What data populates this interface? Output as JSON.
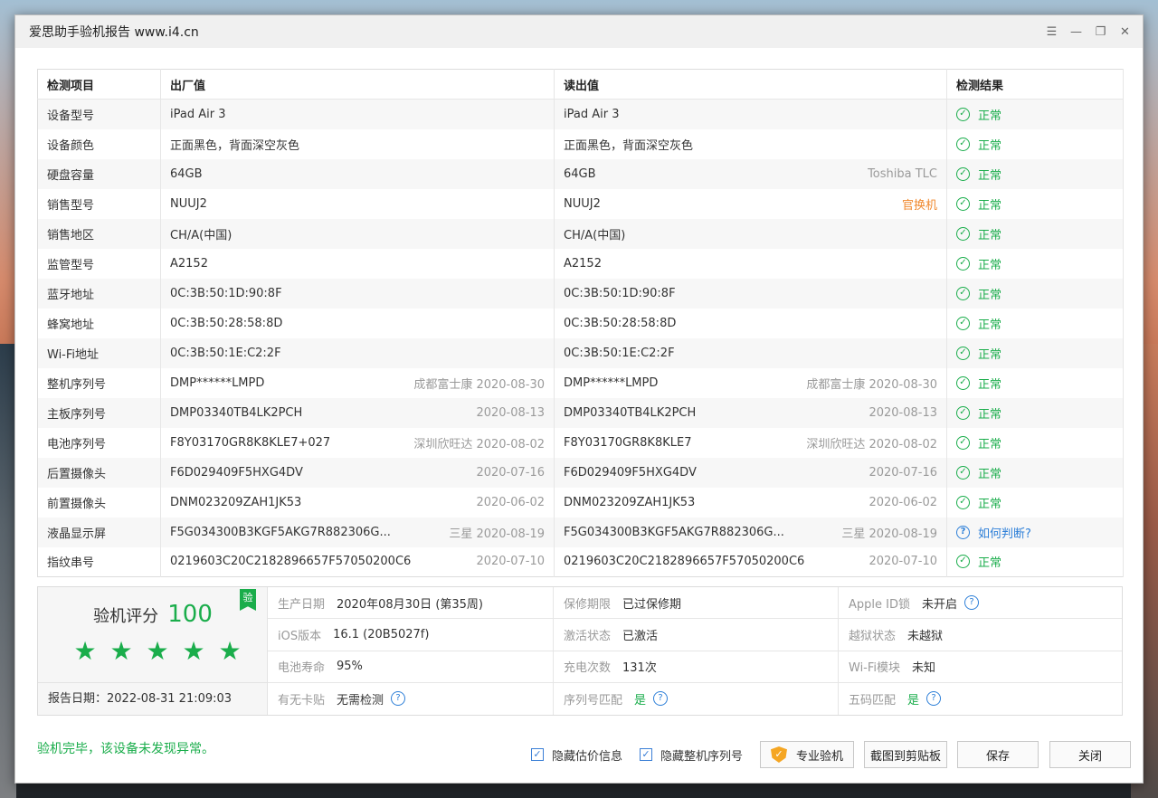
{
  "window": {
    "title": "爱思助手验机报告 www.i4.cn"
  },
  "icons": {
    "menu": "menu-icon",
    "minimize": "minimize-icon",
    "restore": "restore-icon",
    "close": "close-icon"
  },
  "table": {
    "headers": [
      "检测项目",
      "出厂值",
      "读出值",
      "检测结果"
    ],
    "rows": [
      {
        "item": "设备型号",
        "factory": "iPad Air 3",
        "factory_extra": "",
        "read": "iPad Air 3",
        "read_extra": "",
        "result": "正常",
        "result_type": "ok"
      },
      {
        "item": "设备颜色",
        "factory": "正面黑色，背面深空灰色",
        "factory_extra": "",
        "read": "正面黑色，背面深空灰色",
        "read_extra": "",
        "result": "正常",
        "result_type": "ok"
      },
      {
        "item": "硬盘容量",
        "factory": "64GB",
        "factory_extra": "",
        "read": "64GB",
        "read_extra": "Toshiba TLC",
        "result": "正常",
        "result_type": "ok"
      },
      {
        "item": "销售型号",
        "factory": "NUUJ2",
        "factory_extra": "",
        "read": "NUUJ2",
        "read_extra": "官换机",
        "read_extra_color": "orange",
        "result": "正常",
        "result_type": "ok"
      },
      {
        "item": "销售地区",
        "factory": "CH/A(中国)",
        "factory_extra": "",
        "read": "CH/A(中国)",
        "read_extra": "",
        "result": "正常",
        "result_type": "ok"
      },
      {
        "item": "监管型号",
        "factory": "A2152",
        "factory_extra": "",
        "read": "A2152",
        "read_extra": "",
        "result": "正常",
        "result_type": "ok"
      },
      {
        "item": "蓝牙地址",
        "factory": "0C:3B:50:1D:90:8F",
        "factory_extra": "",
        "read": "0C:3B:50:1D:90:8F",
        "read_extra": "",
        "result": "正常",
        "result_type": "ok"
      },
      {
        "item": "蜂窝地址",
        "factory": "0C:3B:50:28:58:8D",
        "factory_extra": "",
        "read": "0C:3B:50:28:58:8D",
        "read_extra": "",
        "result": "正常",
        "result_type": "ok"
      },
      {
        "item": "Wi-Fi地址",
        "factory": "0C:3B:50:1E:C2:2F",
        "factory_extra": "",
        "read": "0C:3B:50:1E:C2:2F",
        "read_extra": "",
        "result": "正常",
        "result_type": "ok"
      },
      {
        "item": "整机序列号",
        "factory": "DMP******LMPD",
        "factory_extra": "成都富士康 2020-08-30",
        "read": "DMP******LMPD",
        "read_extra": "成都富士康 2020-08-30",
        "result": "正常",
        "result_type": "ok"
      },
      {
        "item": "主板序列号",
        "factory": "DMP03340TB4LK2PCH",
        "factory_extra": "2020-08-13",
        "read": "DMP03340TB4LK2PCH",
        "read_extra": "2020-08-13",
        "result": "正常",
        "result_type": "ok"
      },
      {
        "item": "电池序列号",
        "factory": "F8Y03170GR8K8KLE7+027",
        "factory_extra": "深圳欣旺达 2020-08-02",
        "read": "F8Y03170GR8K8KLE7",
        "read_extra": "深圳欣旺达 2020-08-02",
        "result": "正常",
        "result_type": "ok"
      },
      {
        "item": "后置摄像头",
        "factory": "F6D029409F5HXG4DV",
        "factory_extra": "2020-07-16",
        "read": "F6D029409F5HXG4DV",
        "read_extra": "2020-07-16",
        "result": "正常",
        "result_type": "ok"
      },
      {
        "item": "前置摄像头",
        "factory": "DNM023209ZAH1JK53",
        "factory_extra": "2020-06-02",
        "read": "DNM023209ZAH1JK53",
        "read_extra": "2020-06-02",
        "result": "正常",
        "result_type": "ok"
      },
      {
        "item": "液晶显示屏",
        "factory": "F5G034300B3KGF5AKG7R882306G...",
        "factory_extra": "三星 2020-08-19",
        "read": "F5G034300B3KGF5AKG7R882306G...",
        "read_extra": "三星 2020-08-19",
        "result": "如何判断?",
        "result_type": "help"
      },
      {
        "item": "指纹串号",
        "factory": "0219603C20C2182896657F57050200C6",
        "factory_extra": "2020-07-10",
        "read": "0219603C20C2182896657F57050200C6",
        "read_extra": "2020-07-10",
        "result": "正常",
        "result_type": "ok"
      }
    ]
  },
  "summary": {
    "score_label": "验机评分",
    "score": "100",
    "badge": "验",
    "stars": 5,
    "report_date": "报告日期：2022-08-31 21:09:03",
    "info": [
      {
        "k": "生产日期",
        "v": "2020年08月30日 (第35周)"
      },
      {
        "k": "保修期限",
        "v": "已过保修期"
      },
      {
        "k": "Apple ID锁",
        "v": "未开启",
        "q": true
      },
      {
        "k": "iOS版本",
        "v": "16.1 (20B5027f)"
      },
      {
        "k": "激活状态",
        "v": "已激活"
      },
      {
        "k": "越狱状态",
        "v": "未越狱"
      },
      {
        "k": "电池寿命",
        "v": "95%"
      },
      {
        "k": "充电次数",
        "v": "131次"
      },
      {
        "k": "Wi-Fi模块",
        "v": "未知"
      },
      {
        "k": "有无卡贴",
        "v": "无需检测",
        "q": true
      },
      {
        "k": "序列号匹配",
        "v": "是",
        "green": true,
        "q": true
      },
      {
        "k": "五码匹配",
        "v": "是",
        "green": true,
        "q": true
      }
    ]
  },
  "footer": {
    "status": "验机完毕，该设备未发现异常。",
    "hide_price": "隐藏估价信息",
    "hide_serial": "隐藏整机序列号",
    "pro_check": "专业验机",
    "screenshot": "截图到剪贴板",
    "save": "保存",
    "close": "关闭"
  },
  "colors": {
    "accent_green": "#1aad4b",
    "link_blue": "#2d7fd8",
    "warn_orange": "#f0882d"
  }
}
